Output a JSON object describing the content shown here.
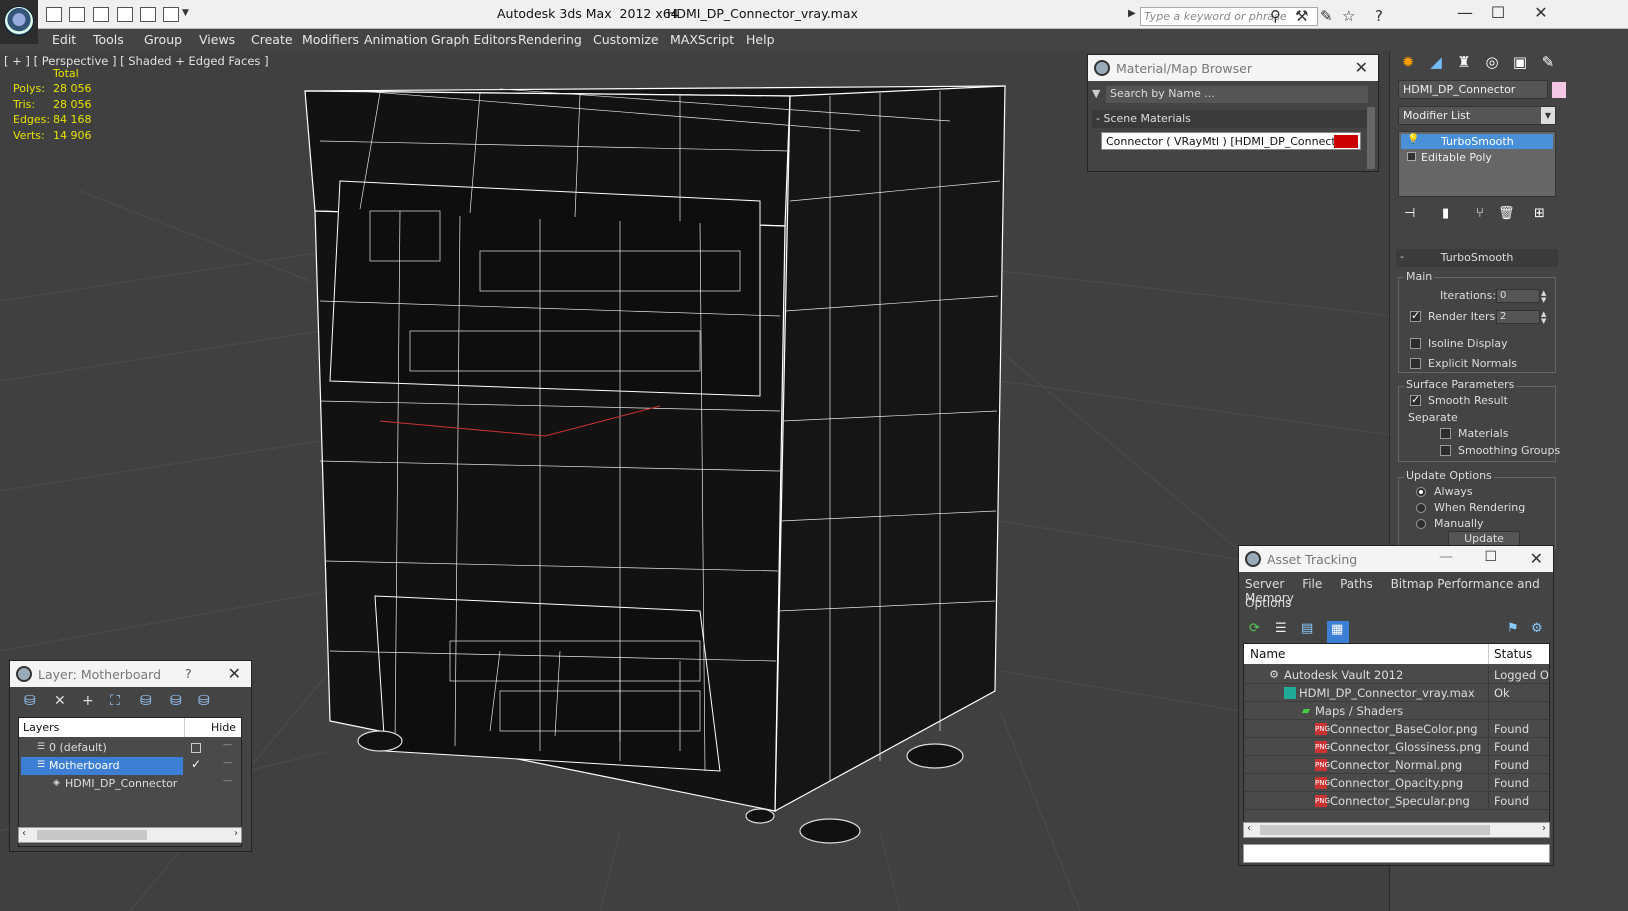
{
  "window": {
    "title": "Autodesk 3ds Max  2012 x64",
    "file": "HDMI_DP_Connector_vray.max",
    "search_placeholder": "Type a keyword or phrase"
  },
  "menu": [
    "Edit",
    "Tools",
    "Group",
    "Views",
    "Create",
    "Modifiers",
    "Animation",
    "Graph Editors",
    "Rendering",
    "Customize",
    "MAXScript",
    "Help"
  ],
  "viewport": {
    "label": "[ + ] [ Perspective ] [ Shaded + Edged Faces ]",
    "stats": {
      "total_label": "Total",
      "rows": [
        {
          "k": "Polys:",
          "v": "28 056"
        },
        {
          "k": "Tris:",
          "v": "28 056"
        },
        {
          "k": "Edges:",
          "v": "84 168"
        },
        {
          "k": "Verts:",
          "v": "14 906"
        }
      ]
    }
  },
  "material_browser": {
    "title": "Material/Map Browser",
    "search": "Search by Name ...",
    "group": "- Scene Materials",
    "item": "Connector  ( VRayMtl )  [HDMI_DP_Connector]",
    "swatch_color": "#cc0000"
  },
  "command_panel": {
    "object_name": "HDMI_DP_Connector",
    "object_color": "#f4c8e4",
    "modifier_list": "Modifier List",
    "stack": [
      "TurboSmooth",
      "Editable Poly"
    ],
    "turbosmooth": {
      "header": "TurboSmooth",
      "main": "Main",
      "iterations_label": "Iterations:",
      "iterations": "0",
      "render_iters_label": "Render Iters:",
      "render_iters": "2",
      "isoline": "Isoline Display",
      "explicit_normals": "Explicit Normals",
      "surface_params": "Surface Parameters",
      "smooth_result": "Smooth Result",
      "separate": "Separate",
      "materials": "Materials",
      "smoothing_groups": "Smoothing Groups",
      "update_options": "Update Options",
      "always": "Always",
      "when_rendering": "When Rendering",
      "manually": "Manually",
      "update": "Update"
    }
  },
  "layer_panel": {
    "title": "Layer: Motherboard",
    "help": "?",
    "col_layers": "Layers",
    "col_hide": "Hide",
    "rows": [
      "0 (default)",
      "Motherboard",
      "HDMI_DP_Connector"
    ]
  },
  "asset_tracking": {
    "title": "Asset Tracking",
    "menu": [
      "Server",
      "File",
      "Paths",
      "Bitmap Performance and Memory"
    ],
    "menu2": "Options",
    "col_name": "Name",
    "col_status": "Status",
    "rows": [
      {
        "name": "Autodesk Vault 2012",
        "status": "Logged Out"
      },
      {
        "name": "HDMI_DP_Connector_vray.max",
        "status": "Ok"
      },
      {
        "name": "Maps / Shaders",
        "status": ""
      },
      {
        "name": "Connector_BaseColor.png",
        "status": "Found"
      },
      {
        "name": "Connector_Glossiness.png",
        "status": "Found"
      },
      {
        "name": "Connector_Normal.png",
        "status": "Found"
      },
      {
        "name": "Connector_Opacity.png",
        "status": "Found"
      },
      {
        "name": "Connector_Specular.png",
        "status": "Found"
      }
    ]
  }
}
